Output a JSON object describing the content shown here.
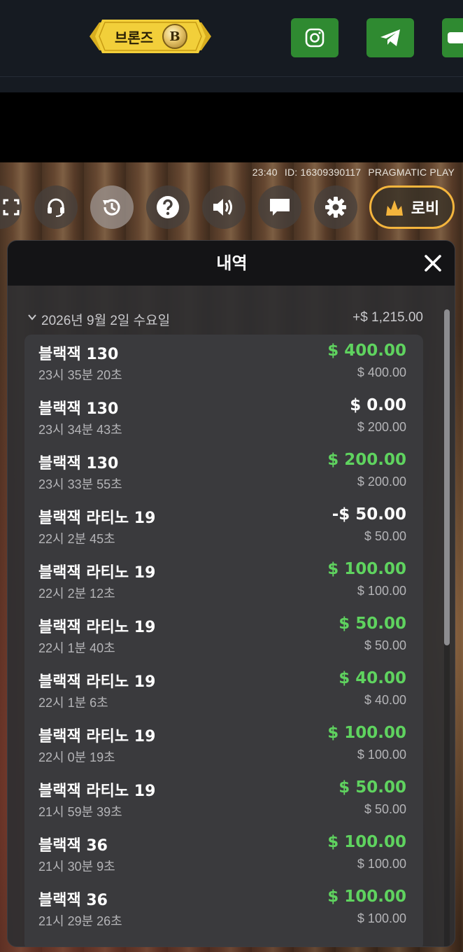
{
  "header": {
    "rank_label": "브론즈",
    "rank_coin_letter": "B",
    "social": [
      {
        "name": "instagram-icon"
      },
      {
        "name": "telegram-icon"
      },
      {
        "name": "youtube-icon"
      }
    ],
    "colors": {
      "social_green": "#2f8a31",
      "badge_gold": "#f2cf3a"
    }
  },
  "stream": {
    "time": "23:40",
    "id": "ID: 16309390117",
    "provider": "PRAGMATIC PLAY"
  },
  "controls": [
    {
      "name": "fullscreen-icon"
    },
    {
      "name": "support-headset-icon"
    },
    {
      "name": "history-icon",
      "active": true
    },
    {
      "name": "help-icon"
    },
    {
      "name": "sound-icon"
    },
    {
      "name": "chat-icon"
    },
    {
      "name": "settings-gear-icon"
    }
  ],
  "lobby": {
    "label": "로비",
    "accent": "#f4b53d"
  },
  "history": {
    "title": "내역",
    "date_label": "2026년 9월 2일 수요일",
    "date_total": "+$ 1,215.00",
    "rows": [
      {
        "game": "블랙잭 130",
        "time": "23시 35분 20초",
        "result": "$ 400.00",
        "bet": "$ 400.00",
        "win": true
      },
      {
        "game": "블랙잭 130",
        "time": "23시 34분 43초",
        "result": "$ 0.00",
        "bet": "$ 200.00",
        "win": false
      },
      {
        "game": "블랙잭 130",
        "time": "23시 33분 55초",
        "result": "$ 200.00",
        "bet": "$ 200.00",
        "win": true
      },
      {
        "game": "블랙잭 라티노 19",
        "time": "22시 2분 45초",
        "result": "-$ 50.00",
        "bet": "$ 50.00",
        "win": false
      },
      {
        "game": "블랙잭 라티노 19",
        "time": "22시 2분 12초",
        "result": "$ 100.00",
        "bet": "$ 100.00",
        "win": true
      },
      {
        "game": "블랙잭 라티노 19",
        "time": "22시 1분 40초",
        "result": "$ 50.00",
        "bet": "$ 50.00",
        "win": true
      },
      {
        "game": "블랙잭 라티노 19",
        "time": "22시 1분 6초",
        "result": "$ 40.00",
        "bet": "$ 40.00",
        "win": true
      },
      {
        "game": "블랙잭 라티노 19",
        "time": "22시 0분 19초",
        "result": "$ 100.00",
        "bet": "$ 100.00",
        "win": true
      },
      {
        "game": "블랙잭 라티노 19",
        "time": "21시 59분 39초",
        "result": "$ 50.00",
        "bet": "$ 50.00",
        "win": true
      },
      {
        "game": "블랙잭 36",
        "time": "21시 30분 9초",
        "result": "$ 100.00",
        "bet": "$ 100.00",
        "win": true
      },
      {
        "game": "블랙잭 36",
        "time": "21시 29분 26초",
        "result": "$ 100.00",
        "bet": "$ 100.00",
        "win": true
      }
    ],
    "colors": {
      "win": "#5fd35f",
      "neutral": "#ffffff"
    }
  }
}
